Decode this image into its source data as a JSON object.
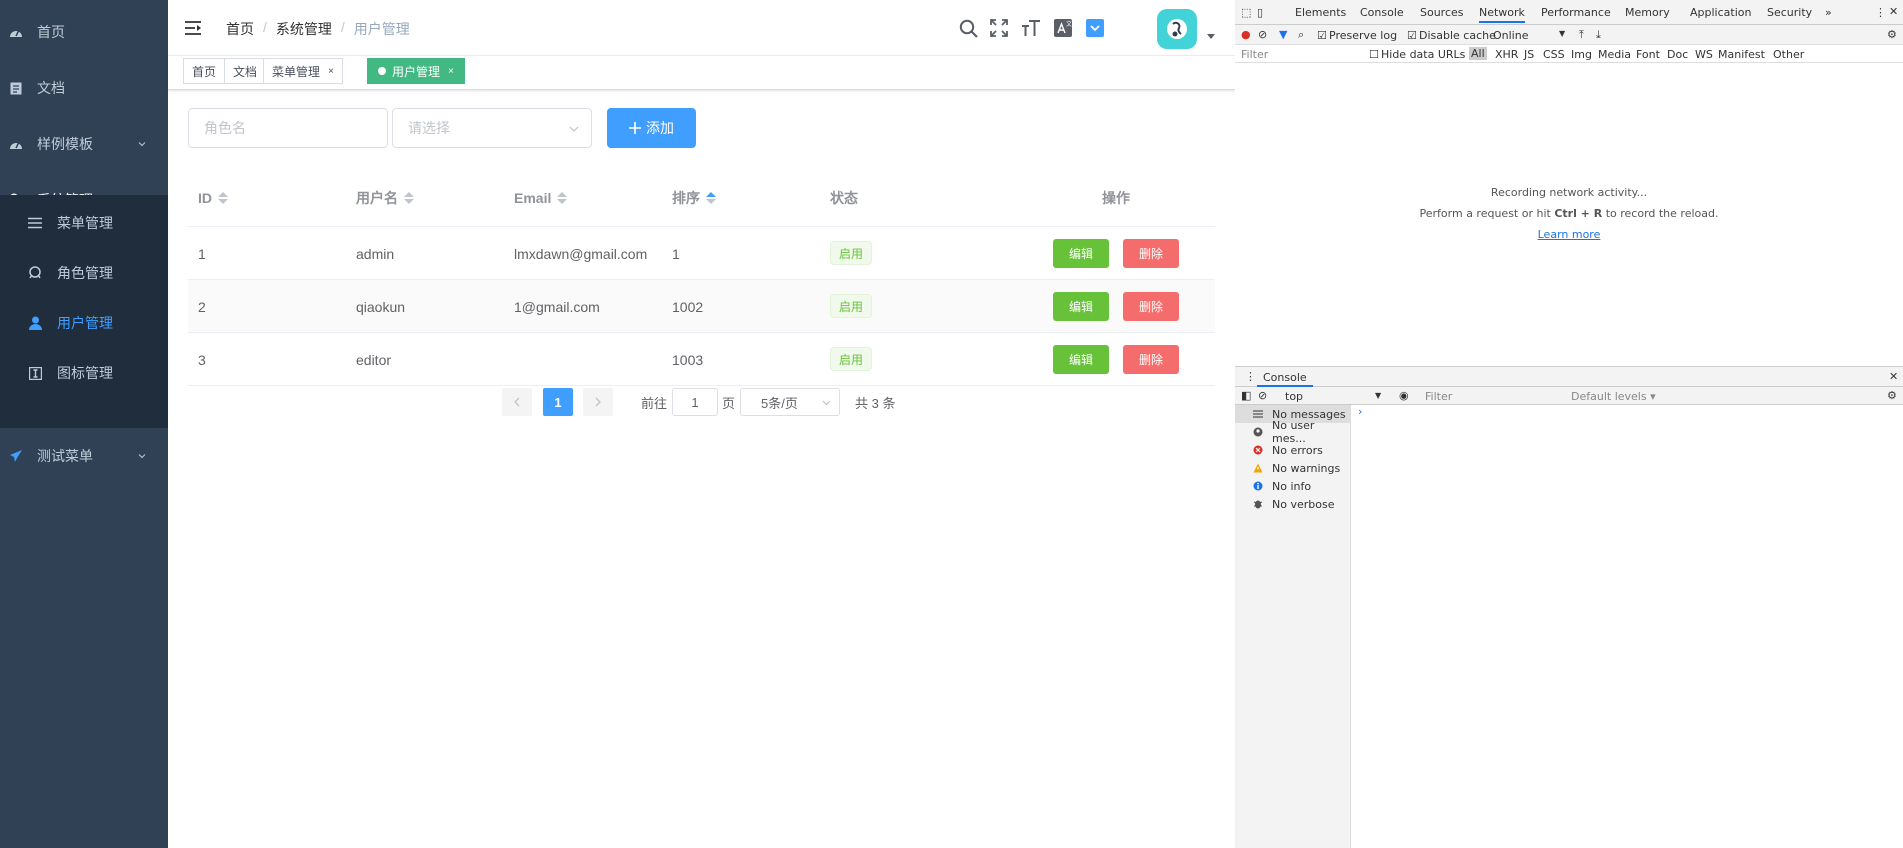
{
  "sidebar": {
    "items": [
      {
        "label": "首页",
        "icon": "dashboard-icon"
      },
      {
        "label": "文档",
        "icon": "document-icon"
      },
      {
        "label": "样例模板",
        "icon": "dashboard-icon"
      },
      {
        "label": "系统管理",
        "icon": "setting-icon"
      },
      {
        "label": "测试菜单",
        "icon": "send-icon"
      }
    ],
    "sub_items": [
      {
        "label": "菜单管理",
        "icon": "list-icon"
      },
      {
        "label": "角色管理",
        "icon": "role-icon"
      },
      {
        "label": "用户管理",
        "icon": "user-icon"
      },
      {
        "label": "图标管理",
        "icon": "icon-icon"
      }
    ],
    "colors": {
      "bg": "#304156",
      "sub_bg": "#1f2d3d",
      "text": "#bfcbd9",
      "active": "#409eff"
    }
  },
  "navbar": {
    "breadcrumb": [
      "首页",
      "系统管理",
      "用户管理"
    ],
    "breadcrumb_sep": "/",
    "icons": [
      "search-icon",
      "fullscreen-icon",
      "size-icon",
      "language-icon",
      "theme-icon"
    ]
  },
  "tags": [
    {
      "label": "首页",
      "closable": false
    },
    {
      "label": "文档",
      "closable": false
    },
    {
      "label": "菜单管理",
      "closable": true
    },
    {
      "label": "用户管理",
      "closable": true,
      "active": true
    }
  ],
  "tag_close": "×",
  "filters": {
    "role_placeholder": "角色名",
    "select_placeholder": "请选择",
    "add_label": "添加"
  },
  "table": {
    "headers": {
      "id": "ID",
      "username": "用户名",
      "email": "Email",
      "sort": "排序",
      "status": "状态",
      "action": "操作"
    },
    "rows": [
      {
        "id": "1",
        "username": "admin",
        "email": "lmxdawn@gmail.com",
        "sort": "1",
        "status": "启用"
      },
      {
        "id": "2",
        "username": "qiaokun",
        "email": "1@gmail.com",
        "sort": "1002",
        "status": "启用"
      },
      {
        "id": "3",
        "username": "editor",
        "email": "",
        "sort": "1003",
        "status": "启用"
      }
    ],
    "edit_label": "编辑",
    "delete_label": "删除"
  },
  "pagination": {
    "current_page": "1",
    "goto_label": "前往",
    "goto_value": "1",
    "page_unit": "页",
    "page_size": "5条/页",
    "total": "共 3 条"
  },
  "devtools": {
    "tabs": [
      "Elements",
      "Console",
      "Sources",
      "Network",
      "Performance",
      "Memory",
      "Application",
      "Security"
    ],
    "active_tab": "Network",
    "more": "»",
    "toolbar": {
      "preserve_log": "Preserve log",
      "disable_cache": "Disable cache",
      "throttle": "Online"
    },
    "filter_placeholder": "Filter",
    "hide_data_urls": "Hide data URLs",
    "types": [
      "All",
      "XHR",
      "JS",
      "CSS",
      "Img",
      "Media",
      "Font",
      "Doc",
      "WS",
      "Manifest",
      "Other"
    ],
    "network_msg": {
      "line1": "Recording network activity...",
      "line2_pre": "Perform a request or hit ",
      "line2_key": "Ctrl + R",
      "line2_post": " to record the reload.",
      "link": "Learn more"
    },
    "console": {
      "title": "Console",
      "context": "top",
      "filter_placeholder": "Filter",
      "levels": "Default levels ▾",
      "sidebar": [
        {
          "label": "No messages",
          "icon": "list-icon"
        },
        {
          "label": "No user mes...",
          "icon": "user-icon"
        },
        {
          "label": "No errors",
          "icon": "error-icon"
        },
        {
          "label": "No warnings",
          "icon": "warning-icon"
        },
        {
          "label": "No info",
          "icon": "info-icon"
        },
        {
          "label": "No verbose",
          "icon": "bug-icon"
        }
      ],
      "prompt": "›"
    }
  }
}
